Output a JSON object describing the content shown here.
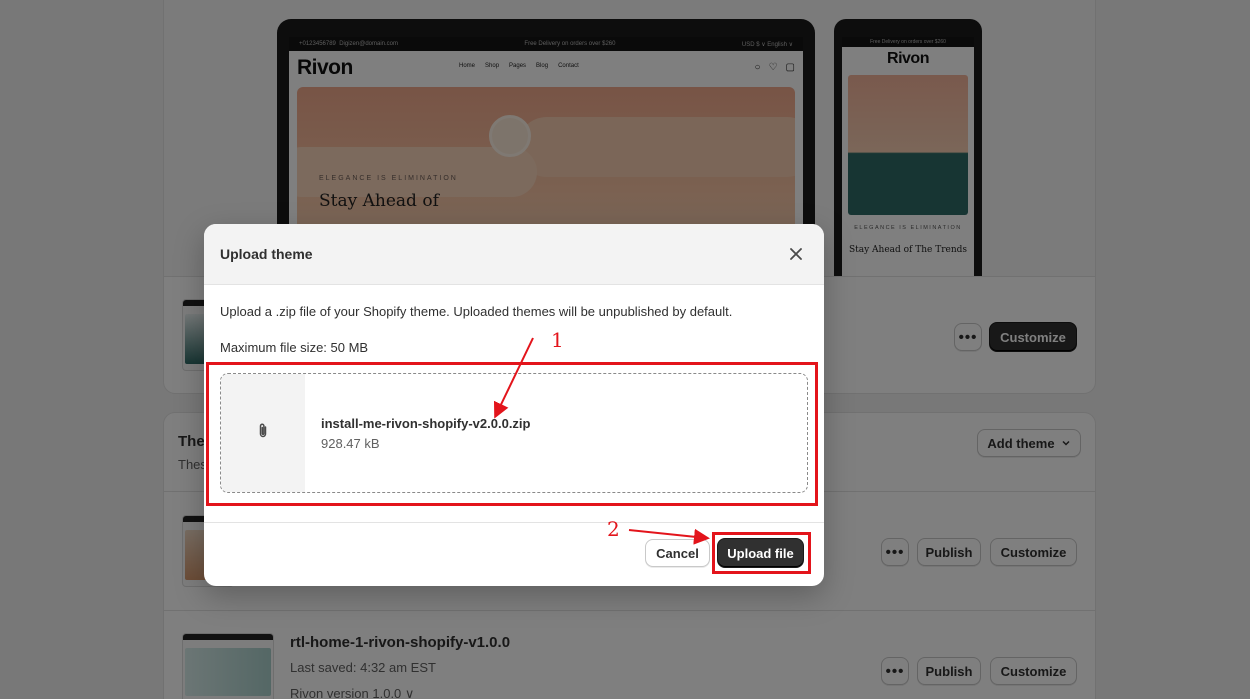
{
  "current_theme": {
    "preview": {
      "topbar_phone": "+0123456789",
      "topbar_email": "Digizen@domain.com",
      "topbar_promo": "Free Delivery on orders over $260",
      "topbar_right": "USD $ ∨  English ∨",
      "logo": "Rivon",
      "nav": [
        "Home",
        "Shop",
        "Pages",
        "Blog",
        "Contact"
      ],
      "hero_tag": "ELEGANCE IS ELIMINATION",
      "hero_title": "Stay Ahead of",
      "phone_tag": "ELEGANCE IS ELIMINATION",
      "phone_title": "Stay Ahead of The Trends"
    },
    "customize_label": "Customize",
    "more_label": "•••"
  },
  "library": {
    "title": "The",
    "subtitle": "Thes",
    "add_theme_label": "Add theme",
    "rows": [
      {
        "publish_label": "Publish",
        "customize_label": "Customize",
        "more_label": "•••"
      },
      {
        "name": "rtl-home-1-rivon-shopify-v1.0.0",
        "last_saved": "Last saved: 4:32 am EST",
        "version": "Rivon version 1.0.0",
        "publish_label": "Publish",
        "customize_label": "Customize",
        "more_label": "•••"
      }
    ]
  },
  "modal": {
    "title": "Upload theme",
    "description": "Upload a .zip file of your Shopify theme. Uploaded themes will be unpublished by default.",
    "max_size": "Maximum file size: 50 MB",
    "file": {
      "name": "install-me-rivon-shopify-v2.0.0.zip",
      "size": "928.47 kB"
    },
    "cancel_label": "Cancel",
    "upload_label": "Upload file"
  },
  "annotations": {
    "step1": "1",
    "step2": "2",
    "color": "#e3141b"
  },
  "icons": {
    "close": "close-icon",
    "attachment": "paperclip-icon",
    "chevron": "chevron-down-icon"
  }
}
